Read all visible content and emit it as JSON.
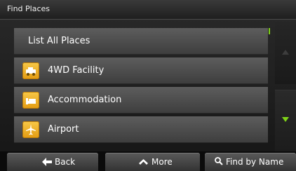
{
  "title": "Find Places",
  "list": {
    "items": [
      {
        "label": "List All Places",
        "icon": null
      },
      {
        "label": "4WD Facility",
        "icon": "jeep-icon"
      },
      {
        "label": "Accommodation",
        "icon": "bed-icon"
      },
      {
        "label": "Airport",
        "icon": "airplane-icon"
      }
    ]
  },
  "scroll": {
    "up_icon": "chevron-up-icon",
    "down_icon": "triangle-down-icon"
  },
  "buttons": {
    "back": "Back",
    "more": "More",
    "find": "Find by Name"
  },
  "colors": {
    "accent": "#7fd317",
    "icon_bg": "#f2b52a"
  }
}
